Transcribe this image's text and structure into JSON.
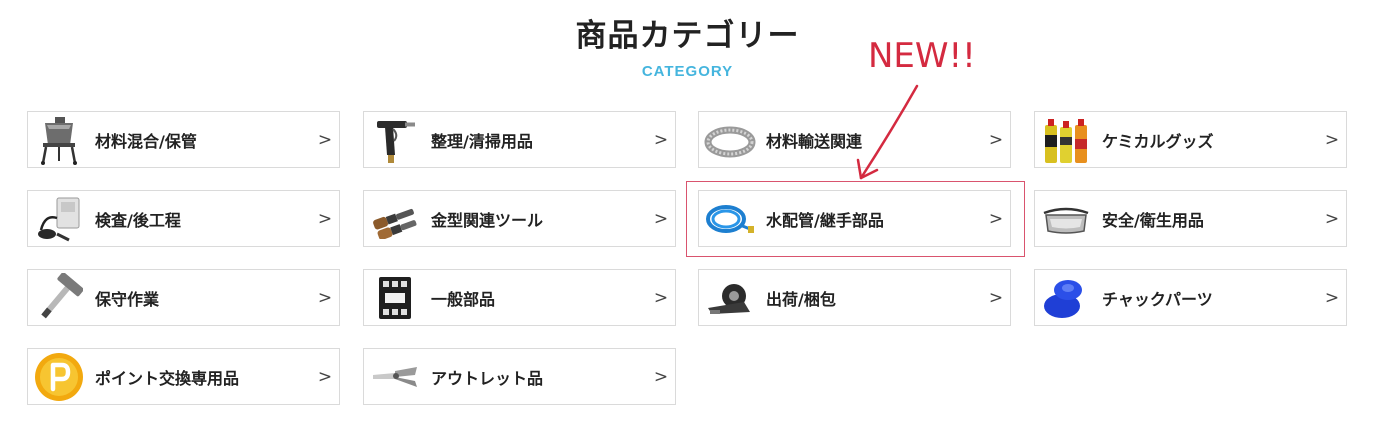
{
  "header": {
    "title": "商品カテゴリー",
    "subtitle": "CATEGORY"
  },
  "annotation": {
    "text": "NEW!!",
    "color": "#d42a40"
  },
  "categories": [
    {
      "label": "材料混合/保管",
      "icon": "mixer-icon",
      "chevron": ">"
    },
    {
      "label": "整理/清掃用品",
      "icon": "air-gun-icon",
      "chevron": ">"
    },
    {
      "label": "材料輸送関連",
      "icon": "hose-icon",
      "chevron": ">"
    },
    {
      "label": "ケミカルグッズ",
      "icon": "spray-cans-icon",
      "chevron": ">"
    },
    {
      "label": "検査/後工程",
      "icon": "inspection-tool-icon",
      "chevron": ">"
    },
    {
      "label": "金型関連ツール",
      "icon": "brushes-icon",
      "chevron": ">"
    },
    {
      "label": "水配管/継手部品",
      "icon": "coiled-hose-icon",
      "chevron": ">"
    },
    {
      "label": "安全/衛生用品",
      "icon": "safety-goggles-icon",
      "chevron": ">"
    },
    {
      "label": "保守作業",
      "icon": "hammer-icon",
      "chevron": ">"
    },
    {
      "label": "一般部品",
      "icon": "contactor-icon",
      "chevron": ">"
    },
    {
      "label": "出荷/梱包",
      "icon": "tape-dispenser-icon",
      "chevron": ">"
    },
    {
      "label": "チャックパーツ",
      "icon": "suction-cup-icon",
      "chevron": ">"
    },
    {
      "label": "ポイント交換専用品",
      "icon": "point-coin-icon",
      "chevron": ">"
    },
    {
      "label": "アウトレット品",
      "icon": "nippers-icon",
      "chevron": ">"
    }
  ],
  "colors": {
    "accent": "#45b5de",
    "highlight": "#d9546e",
    "border": "#dadada"
  }
}
